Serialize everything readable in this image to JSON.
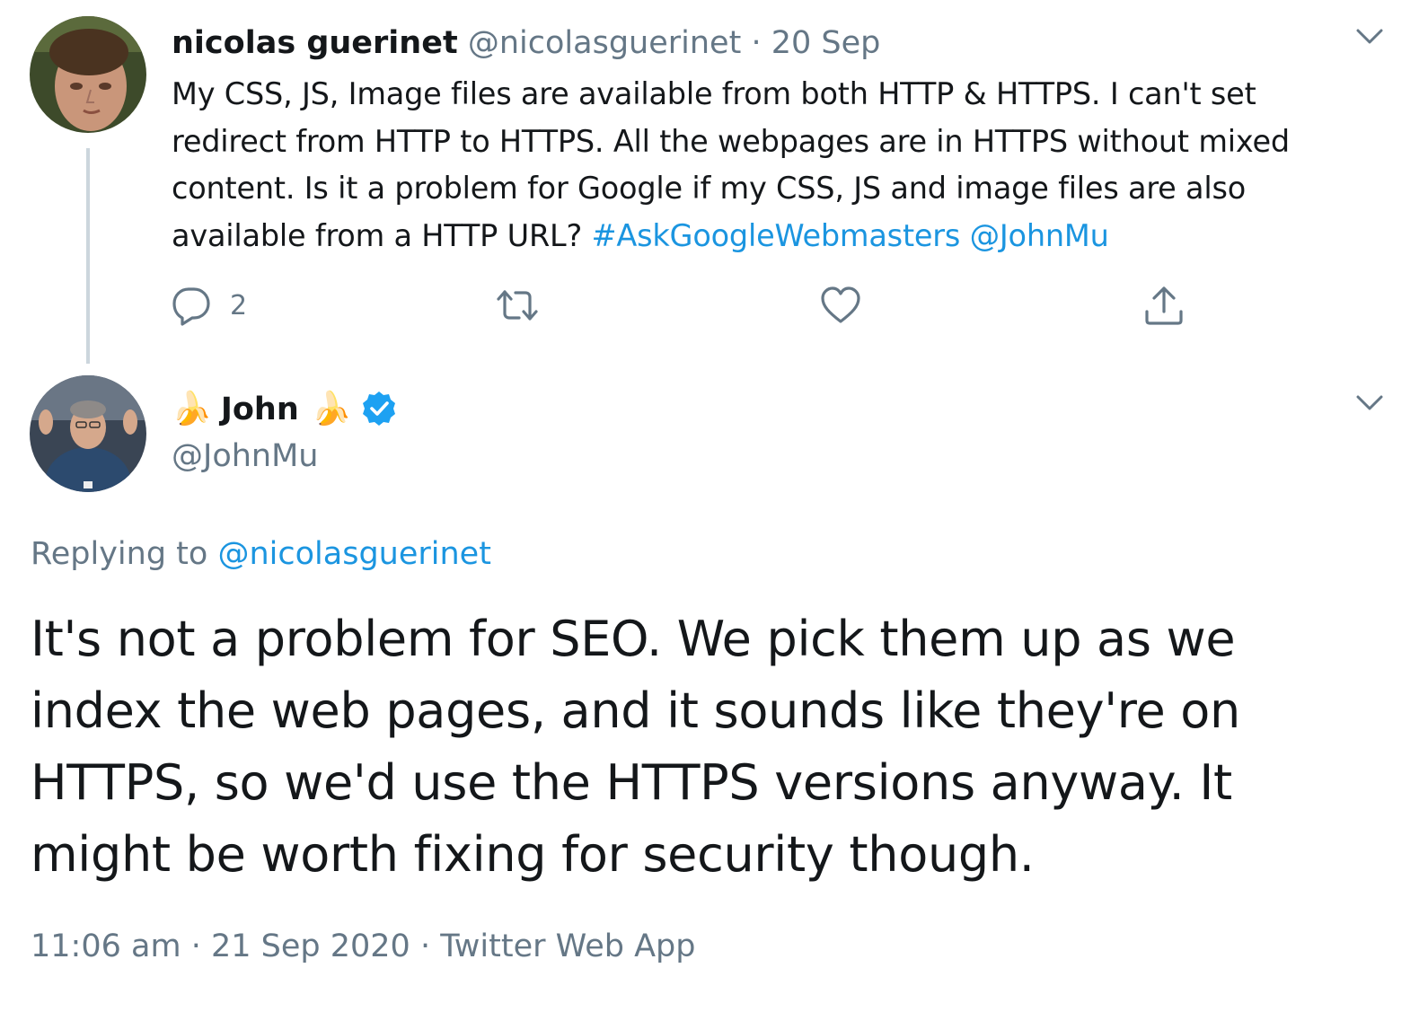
{
  "parent_tweet": {
    "name": "nicolas guerinet",
    "handle": "@nicolasguerinet",
    "separator": "·",
    "date": "20 Sep",
    "text": "My CSS, JS, Image files are available from both HTTP & HTTPS. I can't set redirect from HTTP to HTTPS. All the webpages are in HTTPS without mixed content.  Is it a problem for Google if my CSS, JS and image files are also available from a HTTP URL?",
    "hashtag": "#AskGoogleWebmasters",
    "mention": "@JohnMu",
    "reply_count": "2",
    "icons": {
      "reply": "reply-icon",
      "retweet": "retweet-icon",
      "like": "heart-icon",
      "share": "share-icon",
      "menu": "chevron-down-icon"
    }
  },
  "main_tweet": {
    "banana_left": "🍌",
    "name": "John",
    "banana_right": "🍌",
    "verified_icon": "verified-badge-icon",
    "handle": "@JohnMu",
    "replying_prefix": "Replying to",
    "replying_to": "@nicolasguerinet",
    "text": "It's not a problem for SEO. We pick them up as we index the web pages, and it sounds like they're on HTTPS, so we'd use the HTTPS versions anyway. It might be worth fixing for security though.",
    "time": "11:06 am",
    "meta_separator_1": "·",
    "date": "21 Sep 2020",
    "meta_separator_2": "·",
    "source": "Twitter Web App"
  },
  "colors": {
    "text": "#14171a",
    "muted": "#657786",
    "link": "#1b95e0",
    "thread_line": "#ccd6dd",
    "verified": "#1da1f2"
  }
}
